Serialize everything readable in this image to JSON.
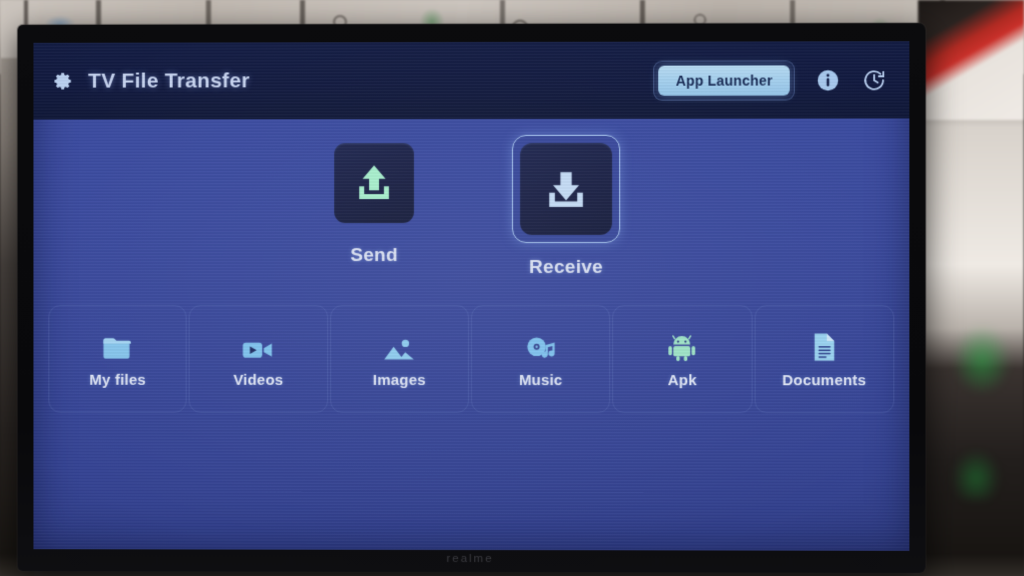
{
  "device": {
    "brand": "realme"
  },
  "header": {
    "gear_icon": "gear-icon",
    "title": "TV File Transfer",
    "app_launcher_label": "App Launcher",
    "info_icon": "info-icon",
    "history_icon": "history-clock-icon"
  },
  "transfer": {
    "items": [
      {
        "label": "Send",
        "icon": "upload-arrow-icon",
        "focused": false,
        "color": "#a8f0ce"
      },
      {
        "label": "Receive",
        "icon": "download-arrow-icon",
        "focused": true,
        "color": "#c5ddf7"
      }
    ]
  },
  "categories": {
    "items": [
      {
        "label": "My files",
        "icon": "folder-icon",
        "color": "#87c6ee"
      },
      {
        "label": "Videos",
        "icon": "video-camera-icon",
        "color": "#7fc3ef"
      },
      {
        "label": "Images",
        "icon": "photo-mountain-icon",
        "color": "#8fcdf0"
      },
      {
        "label": "Music",
        "icon": "music-disc-icon",
        "color": "#7fc3ef"
      },
      {
        "label": "Apk",
        "icon": "android-robot-icon",
        "color": "#9fe4c8"
      },
      {
        "label": "Documents",
        "icon": "document-icon",
        "color": "#9ad3f2"
      }
    ]
  },
  "colors": {
    "header_bg": "#131c45",
    "screen_bg": "#3a4a9e",
    "accent": "#a6d2f0",
    "tile_bg": "#1a2046",
    "focus_ring": "#a9c8f2",
    "send_icon": "#a8f0ce",
    "receive_icon": "#c5ddf7",
    "label_text": "#dde4f5"
  }
}
